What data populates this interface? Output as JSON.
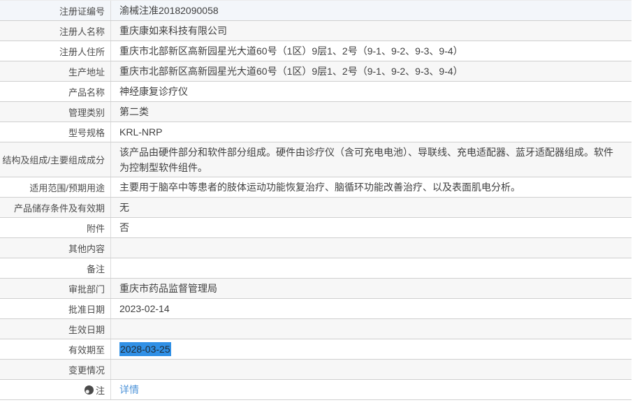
{
  "table": {
    "rows": [
      {
        "label": "注册证编号",
        "value": "渝械注准20182090058"
      },
      {
        "label": "注册人名称",
        "value": "重庆康如来科技有限公司"
      },
      {
        "label": "注册人住所",
        "value": "重庆市北部新区高新园星光大道60号（1区）9层1、2号（9-1、9-2、9-3、9-4）"
      },
      {
        "label": "生产地址",
        "value": "重庆市北部新区高新园星光大道60号（1区）9层1、2号（9-1、9-2、9-3、9-4）"
      },
      {
        "label": "产品名称",
        "value": "神经康复诊疗仪"
      },
      {
        "label": "管理类别",
        "value": "第二类"
      },
      {
        "label": "型号规格",
        "value": "KRL-NRP"
      },
      {
        "label": "结构及组成/主要组成成分",
        "value": "该产品由硬件部分和软件部分组成。硬件由诊疗仪（含可充电电池）、导联线、充电适配器、蓝牙适配器组成。软件为控制型软件组件。",
        "tall": true
      },
      {
        "label": "适用范围/预期用途",
        "value": "主要用于脑卒中等患者的肢体运动功能恢复治疗、脑循环功能改善治疗、以及表面肌电分析。"
      },
      {
        "label": "产品储存条件及有效期",
        "value": "无"
      },
      {
        "label": "附件",
        "value": "否"
      },
      {
        "label": "其他内容",
        "value": ""
      },
      {
        "label": "备注",
        "value": ""
      },
      {
        "label": "审批部门",
        "value": "重庆市药品监督管理局"
      },
      {
        "label": "批准日期",
        "value": "2023-02-14"
      },
      {
        "label": "生效日期",
        "value": ""
      },
      {
        "label": "有效期至",
        "value": "2028-03-25",
        "selected": true
      },
      {
        "label": "变更情况",
        "value": ""
      },
      {
        "label": "注",
        "value": "详情",
        "link": true,
        "icon": "bulb-icon"
      }
    ]
  },
  "colors": {
    "selection_background": "#3090e6",
    "selection_text": "#1f2a33",
    "link": "#4f94d9",
    "row_alt_background": "#f7f7f7",
    "first_row_background": "#f3f6fa",
    "divider": "#cfcfcf"
  }
}
